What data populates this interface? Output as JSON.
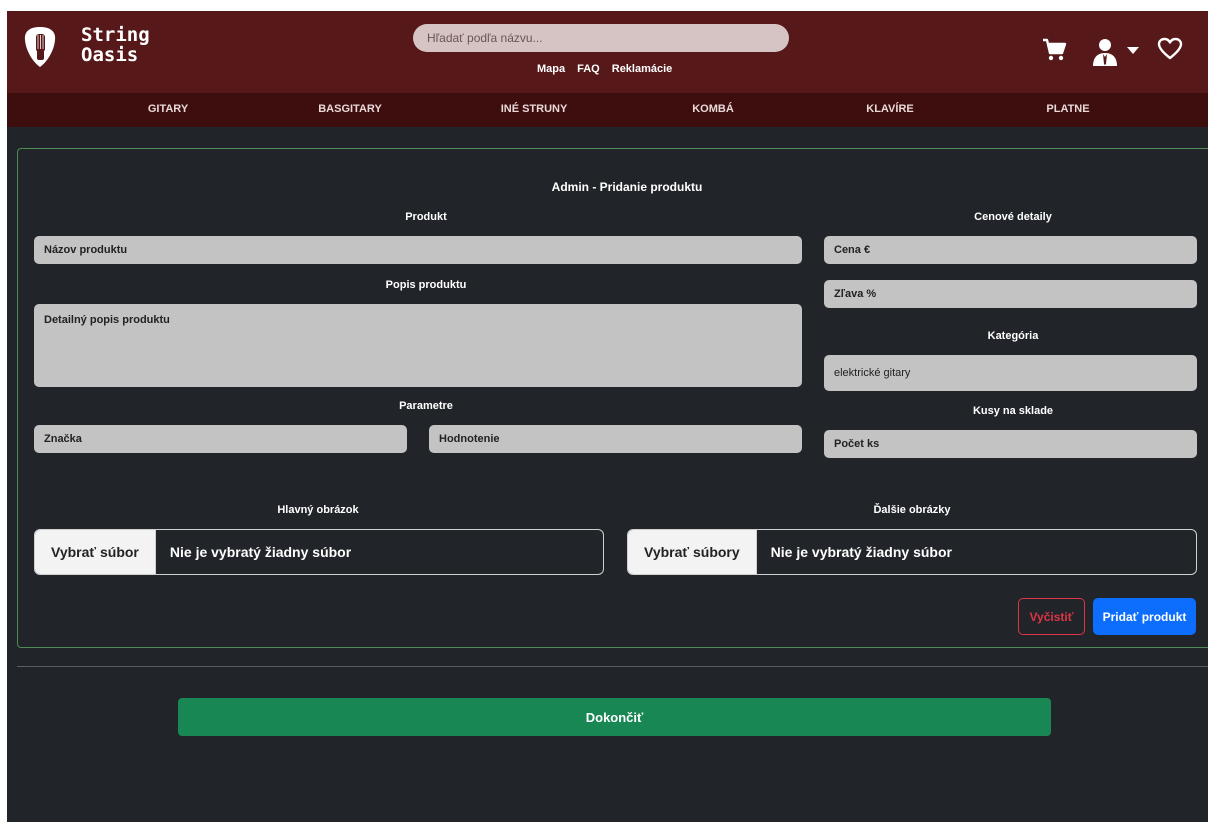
{
  "header": {
    "brand_line1": "String",
    "brand_line2": "Oasis",
    "search_placeholder": "Hľadať podľa názvu...",
    "links": [
      "Mapa",
      "FAQ",
      "Reklamácie"
    ],
    "icons": [
      "cart-icon",
      "user-icon",
      "chevron-down-icon",
      "heart-icon"
    ]
  },
  "nav": {
    "items": [
      "GITARY",
      "BASGITARY",
      "INÉ STRUNY",
      "KOMBÁ",
      "KLAVÍRE",
      "PLATNE"
    ]
  },
  "form": {
    "title": "Admin - Pridanie produktu",
    "product_section": "Produkt",
    "product_name_placeholder": "Názov produktu",
    "description_label": "Popis produktu",
    "description_placeholder": "Detailný popis produktu",
    "parameters_label": "Parametre",
    "brand_placeholder": "Značka",
    "rating_placeholder": "Hodnotenie",
    "price_section": "Cenové detaily",
    "price_placeholder": "Cena €",
    "discount_placeholder": "Zľava %",
    "category_label": "Kategória",
    "category_value": "elektrické gitary",
    "stock_label": "Kusy na sklade",
    "stock_placeholder": "Počet ks",
    "main_image_label": "Hlavný obrázok",
    "main_image_button": "Vybrať súbor",
    "main_image_status": "Nie je vybratý žiadny súbor",
    "more_images_label": "Ďalšie obrázky",
    "more_images_button": "Vybrať súbory",
    "more_images_status": "Nie je vybratý žiadny súbor",
    "clear_button": "Vyčistiť",
    "add_button": "Pridať produkt"
  },
  "footer": {
    "finish_button": "Dokončiť"
  },
  "colors": {
    "header_bg": "#561818",
    "nav_bg": "#3e0d0d",
    "page_bg": "#212529",
    "primary": "#0d6efd",
    "danger": "#dc3545",
    "success": "#198754"
  }
}
